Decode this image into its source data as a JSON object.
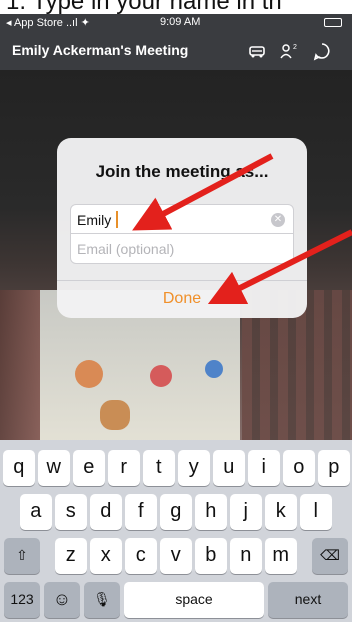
{
  "caption": "1. Type in your name in th",
  "status": {
    "carrier": "◂ App Store ..ıl ✦",
    "time": "9:09 AM"
  },
  "nav": {
    "title": "Emily Ackerman's Meeting"
  },
  "dialog": {
    "title": "Join the meeting as...",
    "name_value": "Emily",
    "email_placeholder": "Email (optional)",
    "done_label": "Done"
  },
  "keyboard": {
    "row1": [
      "q",
      "w",
      "e",
      "r",
      "t",
      "y",
      "u",
      "i",
      "o",
      "p"
    ],
    "row2": [
      "a",
      "s",
      "d",
      "f",
      "g",
      "h",
      "j",
      "k",
      "l"
    ],
    "row3": [
      "z",
      "x",
      "c",
      "v",
      "b",
      "n",
      "m"
    ],
    "shift": "⇧",
    "delete": "⌫",
    "numbers": "123",
    "emoji": "☺",
    "mic": "🎙",
    "space": "space",
    "next": "next"
  },
  "colors": {
    "accent": "#f0902a",
    "arrow": "#e3211c"
  },
  "icons": [
    "car-icon",
    "participants-icon",
    "chat-icon",
    "clear-icon"
  ]
}
